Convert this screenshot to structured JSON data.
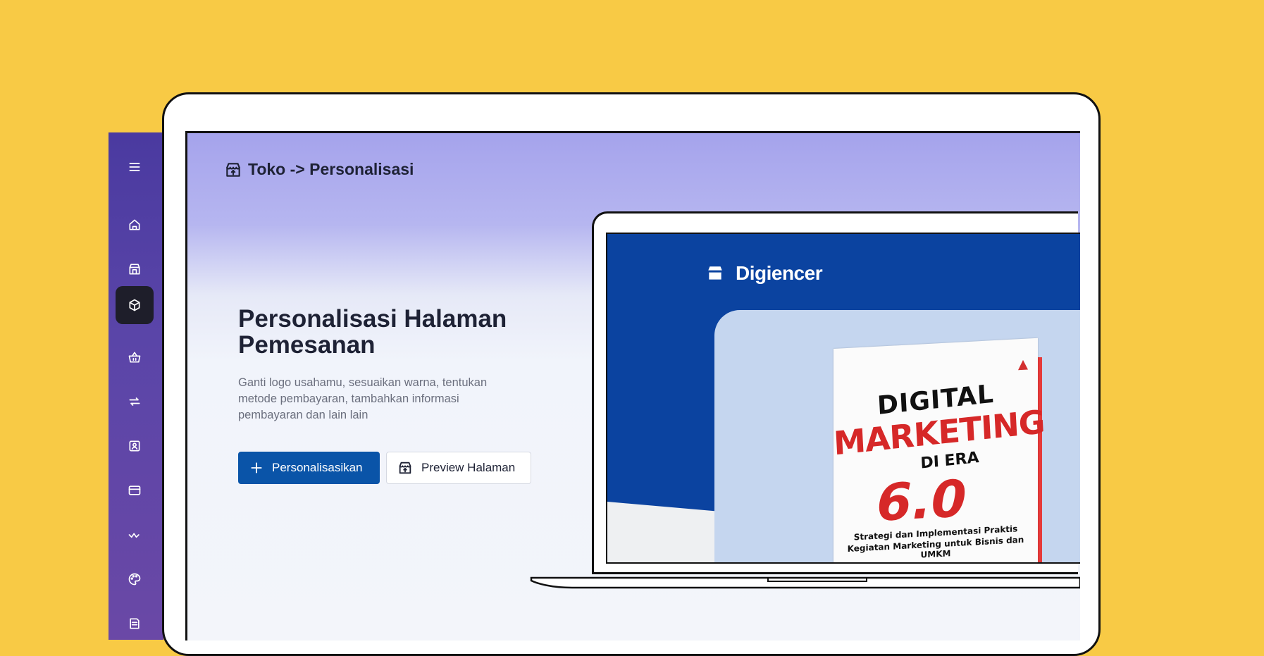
{
  "breadcrumb": {
    "text": "Toko -> Personalisasi",
    "icon": "store-icon"
  },
  "hero": {
    "title": "Personalisasi Halaman Pemesanan",
    "description": "Ganti logo usahamu, sesuaikan warna, tentukan metode pembayaran, tambahkan informasi pembayaran dan lain lain"
  },
  "buttons": {
    "primary_label": "Personalisasikan",
    "secondary_label": "Preview Halaman"
  },
  "sidebar": {
    "items": [
      {
        "icon": "menu-icon"
      },
      {
        "icon": "home-icon"
      },
      {
        "icon": "store-icon"
      },
      {
        "icon": "box-icon",
        "active": true
      },
      {
        "icon": "basket-icon"
      },
      {
        "icon": "transfer-icon"
      },
      {
        "icon": "user-card-icon"
      },
      {
        "icon": "browser-icon"
      },
      {
        "icon": "activity-icon"
      },
      {
        "icon": "palette-icon"
      },
      {
        "icon": "document-icon"
      }
    ]
  },
  "preview": {
    "brand": "Digiencer",
    "book": {
      "line1": "DIGITAL",
      "line2": "MARKETING",
      "line3": "DI ERA",
      "line4": "6.0",
      "subtitle1": "Strategi dan Implementasi Praktis",
      "subtitle2": "Kegiatan Marketing untuk Bisnis dan UMKM"
    }
  },
  "colors": {
    "background": "#f8ca45",
    "sidebar": "#4a3aa0",
    "primary": "#0a54a8",
    "preview_blue": "#0b43a0",
    "book_red": "#d62828"
  }
}
